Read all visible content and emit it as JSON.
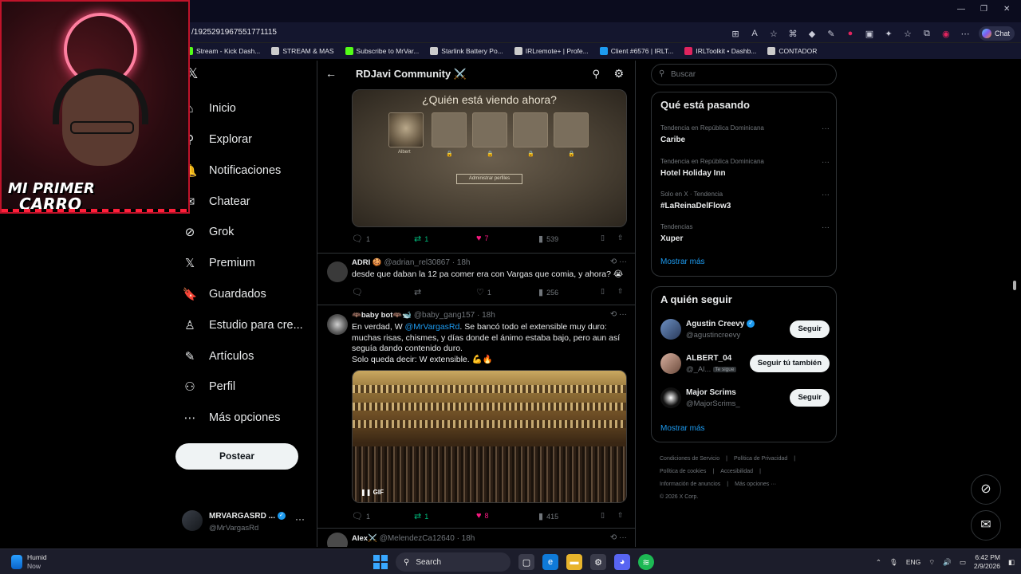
{
  "browser": {
    "url": "/1925291967551771115",
    "chat_label": "Chat",
    "bookmarks": [
      {
        "label": "Stream - Kick Dash...",
        "color": "#53fc18"
      },
      {
        "label": "STREAM & MAS",
        "color": "#cccccc"
      },
      {
        "label": "Subscribe to MrVar...",
        "color": "#53fc18"
      },
      {
        "label": "Starlink Battery Po...",
        "color": "#cccccc"
      },
      {
        "label": "IRLremote+ | Profe...",
        "color": "#cccccc"
      },
      {
        "label": "Client #6576 | IRLT...",
        "color": "#1d9bf0"
      },
      {
        "label": "IRLToolkit • Dashb...",
        "color": "#e0245e"
      },
      {
        "label": "CONTADOR",
        "color": "#cccccc"
      }
    ]
  },
  "webcam": {
    "caption_line1": "MI PRIMER",
    "caption_line2": "CARRO"
  },
  "nav": {
    "items": [
      {
        "label": "Inicio",
        "icon": "home-icon",
        "glyph": "⌂"
      },
      {
        "label": "Explorar",
        "icon": "search-icon",
        "glyph": "⚲"
      },
      {
        "label": "Notificaciones",
        "icon": "bell-icon",
        "glyph": "🔔"
      },
      {
        "label": "Chatear",
        "icon": "mail-icon",
        "glyph": "✉"
      },
      {
        "label": "Grok",
        "icon": "grok-icon",
        "glyph": "⊘"
      },
      {
        "label": "Premium",
        "icon": "x-logo-icon",
        "glyph": "𝕏"
      },
      {
        "label": "Guardados",
        "icon": "bookmark-icon",
        "glyph": "🔖"
      },
      {
        "label": "Estudio para cre...",
        "icon": "studio-icon",
        "glyph": "♙"
      },
      {
        "label": "Artículos",
        "icon": "article-icon",
        "glyph": "✎"
      },
      {
        "label": "Perfil",
        "icon": "person-icon",
        "glyph": "⚇"
      },
      {
        "label": "Más opciones",
        "icon": "more-circle-icon",
        "glyph": "⋯"
      }
    ],
    "post_label": "Postear",
    "account": {
      "name": "MRVARGASRD ...",
      "handle": "@MrVargasRd"
    }
  },
  "community": {
    "title": "RDJavi Community ⚔️",
    "media1": {
      "question": "¿Quién está viendo ahora?",
      "profile_name": "Albert",
      "manage_label": "Administrar perfiles"
    },
    "post1_stats": {
      "replies": "1",
      "reposts": "1",
      "likes": "7",
      "views": "539"
    },
    "tweets": [
      {
        "name": "ADRI 🍪",
        "handle": "@adrian_rel30867 · 18h",
        "text": "desde que daban la 12 pa comer era con Vargas que comia, y ahora? 😭",
        "stats": {
          "replies": "",
          "reposts": "",
          "likes": "1",
          "views": "256"
        }
      },
      {
        "name": "🦇baby bot🦇🐋",
        "handle": "@baby_gang157 · 18h",
        "text_before": "En verdad, W ",
        "mention": "@MrVargasRd",
        "text_after": ". Se bancó todo el extensible muy duro: muchas risas, chismes, y días donde el ánimo estaba bajo, pero aun así seguía dando contenido duro.",
        "text_line2": "Solo queda decir: W extensible. 💪🔥",
        "gif_label": "GIF",
        "stats": {
          "replies": "1",
          "reposts": "1",
          "likes": "8",
          "views": "415"
        }
      },
      {
        "name": "Alex⚔️",
        "handle": "@MelendezCa12640 · 18h"
      }
    ]
  },
  "sidebar": {
    "search_placeholder": "Buscar",
    "trends_title": "Qué está pasando",
    "trends": [
      {
        "context": "Tendencia en República Dominicana",
        "name": "Caribe"
      },
      {
        "context": "Tendencia en República Dominicana",
        "name": "Hotel Holiday Inn"
      },
      {
        "context": "Solo en X · Tendencia",
        "name": "#LaReinaDelFlow3"
      },
      {
        "context": "Tendencias",
        "name": "Xuper"
      }
    ],
    "show_more": "Mostrar más",
    "follow_title": "A quién seguir",
    "follow": [
      {
        "name": "Agustin Creevy",
        "handle": "@agustincreevy",
        "button": "Seguir",
        "verified": true
      },
      {
        "name": "ALBERT_04",
        "handle": "@_Al...",
        "badge": "Te sigue",
        "button": "Seguir tú también"
      },
      {
        "name": "Major Scrims",
        "handle": "@MajorScrims_",
        "button": "Seguir"
      }
    ],
    "footer": [
      "Condiciones de Servicio",
      "|",
      "Política de Privacidad",
      "|",
      "Política de cookies",
      "|",
      "Accesibilidad",
      "|",
      "Información de anuncios",
      "|",
      "Más opciones ···",
      "© 2026 X Corp."
    ]
  },
  "taskbar": {
    "weather_title": "Humid",
    "weather_sub": "Now",
    "search_label": "Search",
    "lang": "ENG",
    "time": "6:42 PM",
    "date": "2/9/2026"
  }
}
